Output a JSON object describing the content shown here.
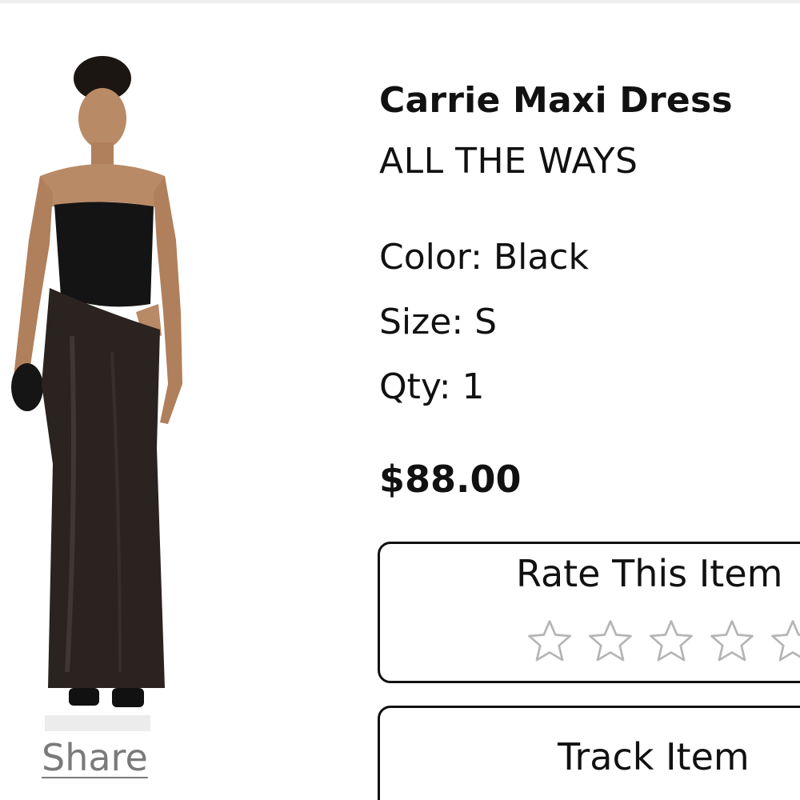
{
  "product": {
    "title": "Carrie Maxi Dress",
    "brand": "ALL THE WAYS",
    "color": "Color: Black",
    "size": "Size: S",
    "qty": "Qty: 1",
    "price": "$88.00",
    "image_alt": "model-wearing-black-strapless-satin-maxi-dress"
  },
  "actions": {
    "share_label": "Share",
    "rate_label": "Rate This Item",
    "rating": {
      "value": 0,
      "max": 5
    },
    "track_label": "Track Item"
  },
  "colors": {
    "text": "#111111",
    "muted_link": "#7a7a7a",
    "star_outline": "#b5b5b5",
    "border": "#111111"
  },
  "icons": {
    "star": "star-outline-icon"
  }
}
